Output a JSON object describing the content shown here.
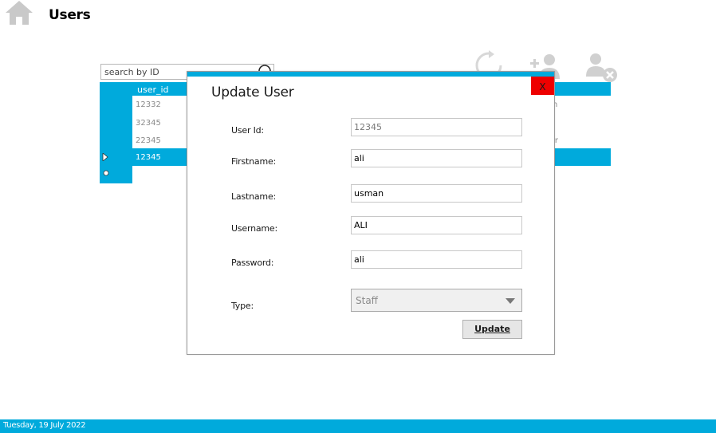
{
  "header": {
    "title": "Users"
  },
  "toolbar": {
    "icons": [
      "home-icon",
      "refresh-icon",
      "add-user-icon",
      "remove-user-icon"
    ],
    "accent_color": "#00aadc",
    "disabled_color": "#d0d0d0"
  },
  "search": {
    "placeholder": "search by ID",
    "value": ""
  },
  "grid": {
    "columns": [
      "user_id"
    ],
    "rows": [
      {
        "user_id": "12332"
      },
      {
        "user_id": "32345"
      },
      {
        "user_id": "22345"
      },
      {
        "user_id": "12345",
        "selected": true
      }
    ],
    "partial_text": {
      "row1_right": "n",
      "row3_right": "ier"
    }
  },
  "dialog": {
    "title": "Update User",
    "close_label": "X",
    "close_color": "#ee0000",
    "fields": {
      "userid": {
        "label": "User Id:",
        "value": "12345"
      },
      "firstname": {
        "label": "Firstname:",
        "value": "ali"
      },
      "lastname": {
        "label": "Lastname:",
        "value": "usman"
      },
      "username": {
        "label": "Username:",
        "value": "ALI"
      },
      "password": {
        "label": "Password:",
        "value": "ali"
      },
      "type": {
        "label": "Type:",
        "value": "Staff"
      }
    },
    "update_label": "Update"
  },
  "footer": {
    "date": "Tuesday, 19 July 2022"
  }
}
